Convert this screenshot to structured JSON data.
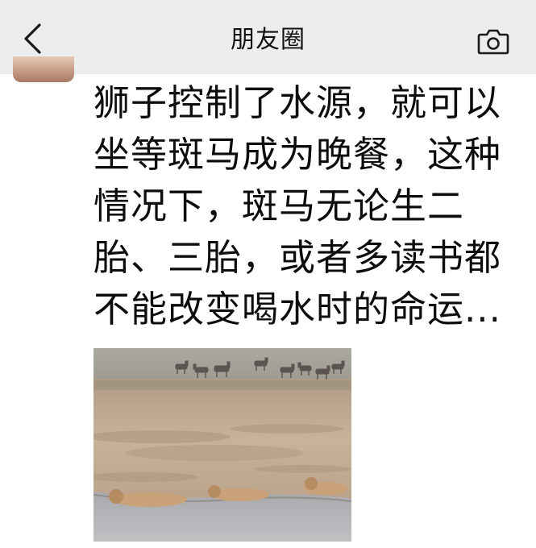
{
  "nav": {
    "title": "朋友圈",
    "back_icon": "chevron-left-icon",
    "camera_icon": "camera-icon"
  },
  "post": {
    "lines": [
      "狮子控制了水源，就可以",
      "坐等斑马成为晚餐，这种",
      "情况下，斑马无论生二",
      "胎、三胎，或者多读书都",
      "不能改变喝水时的命运..."
    ]
  },
  "colors": {
    "navbar_bg": "#ededed",
    "text": "#0d0d0d",
    "page_bg": "#ffffff"
  }
}
